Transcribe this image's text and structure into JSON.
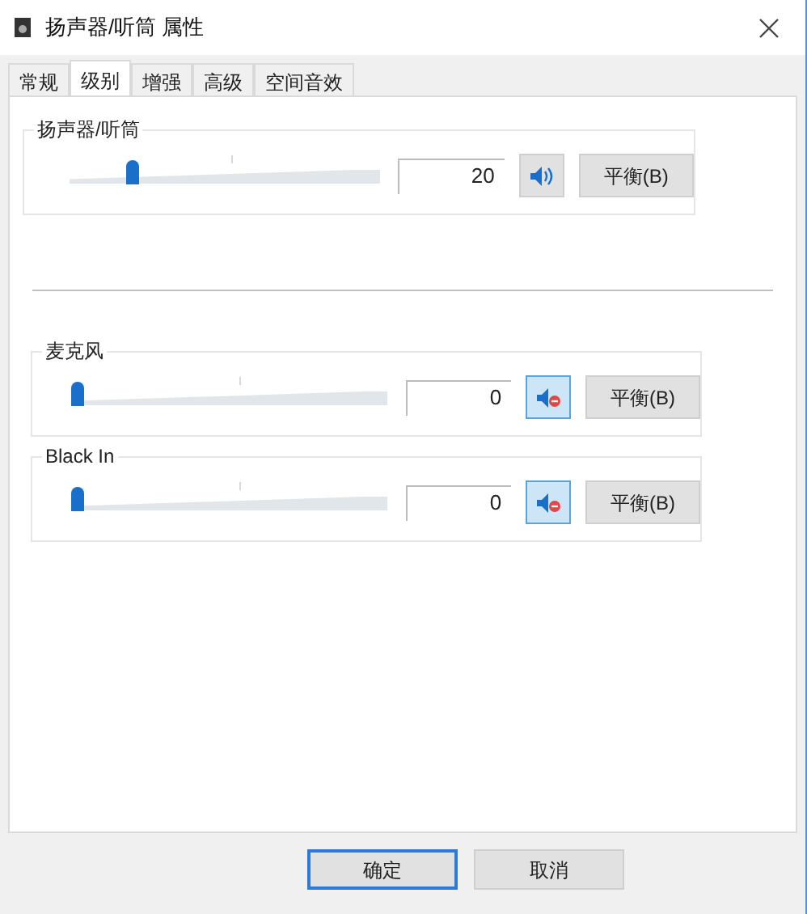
{
  "window": {
    "title": "扬声器/听筒 属性"
  },
  "tabs": [
    {
      "label": "常规",
      "selected": false
    },
    {
      "label": "级别",
      "selected": true
    },
    {
      "label": "增强",
      "selected": false
    },
    {
      "label": "高级",
      "selected": false
    },
    {
      "label": "空间音效",
      "selected": false
    }
  ],
  "channels": [
    {
      "name": "扬声器/听筒",
      "level": 0.2,
      "value": "20",
      "muted": false,
      "balance": "平衡(B)"
    },
    {
      "name": "麦克风",
      "level": 0,
      "value": "0",
      "muted": true,
      "balance": "平衡(B)"
    },
    {
      "name": "Black In",
      "level": 0,
      "value": "0",
      "muted": true,
      "balance": "平衡(B)"
    }
  ],
  "buttons": [
    {
      "label": "确定",
      "default": true
    },
    {
      "label": "取消",
      "default": false
    }
  ]
}
